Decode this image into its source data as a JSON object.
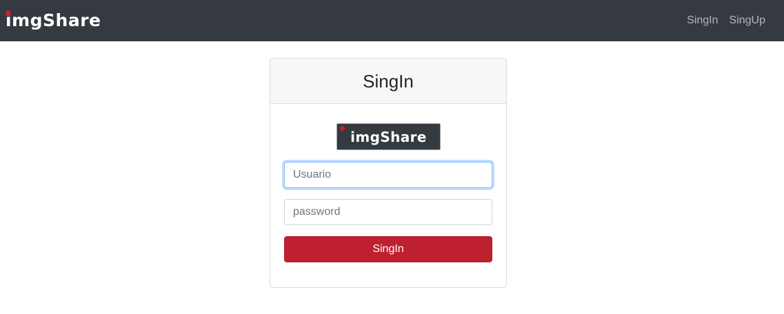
{
  "navbar": {
    "brand": "imgShare",
    "links": [
      {
        "label": "SingIn"
      },
      {
        "label": "SingUp"
      }
    ],
    "background": "#343a40",
    "brand_dot_color": "#cc1f2f"
  },
  "card": {
    "title": "SingIn",
    "logo_text": "imgShare",
    "username": {
      "placeholder": "Usuario",
      "value": "",
      "focused": true
    },
    "password": {
      "placeholder": "password",
      "value": ""
    },
    "submit_label": "SingIn",
    "button_color": "#bf202f"
  }
}
